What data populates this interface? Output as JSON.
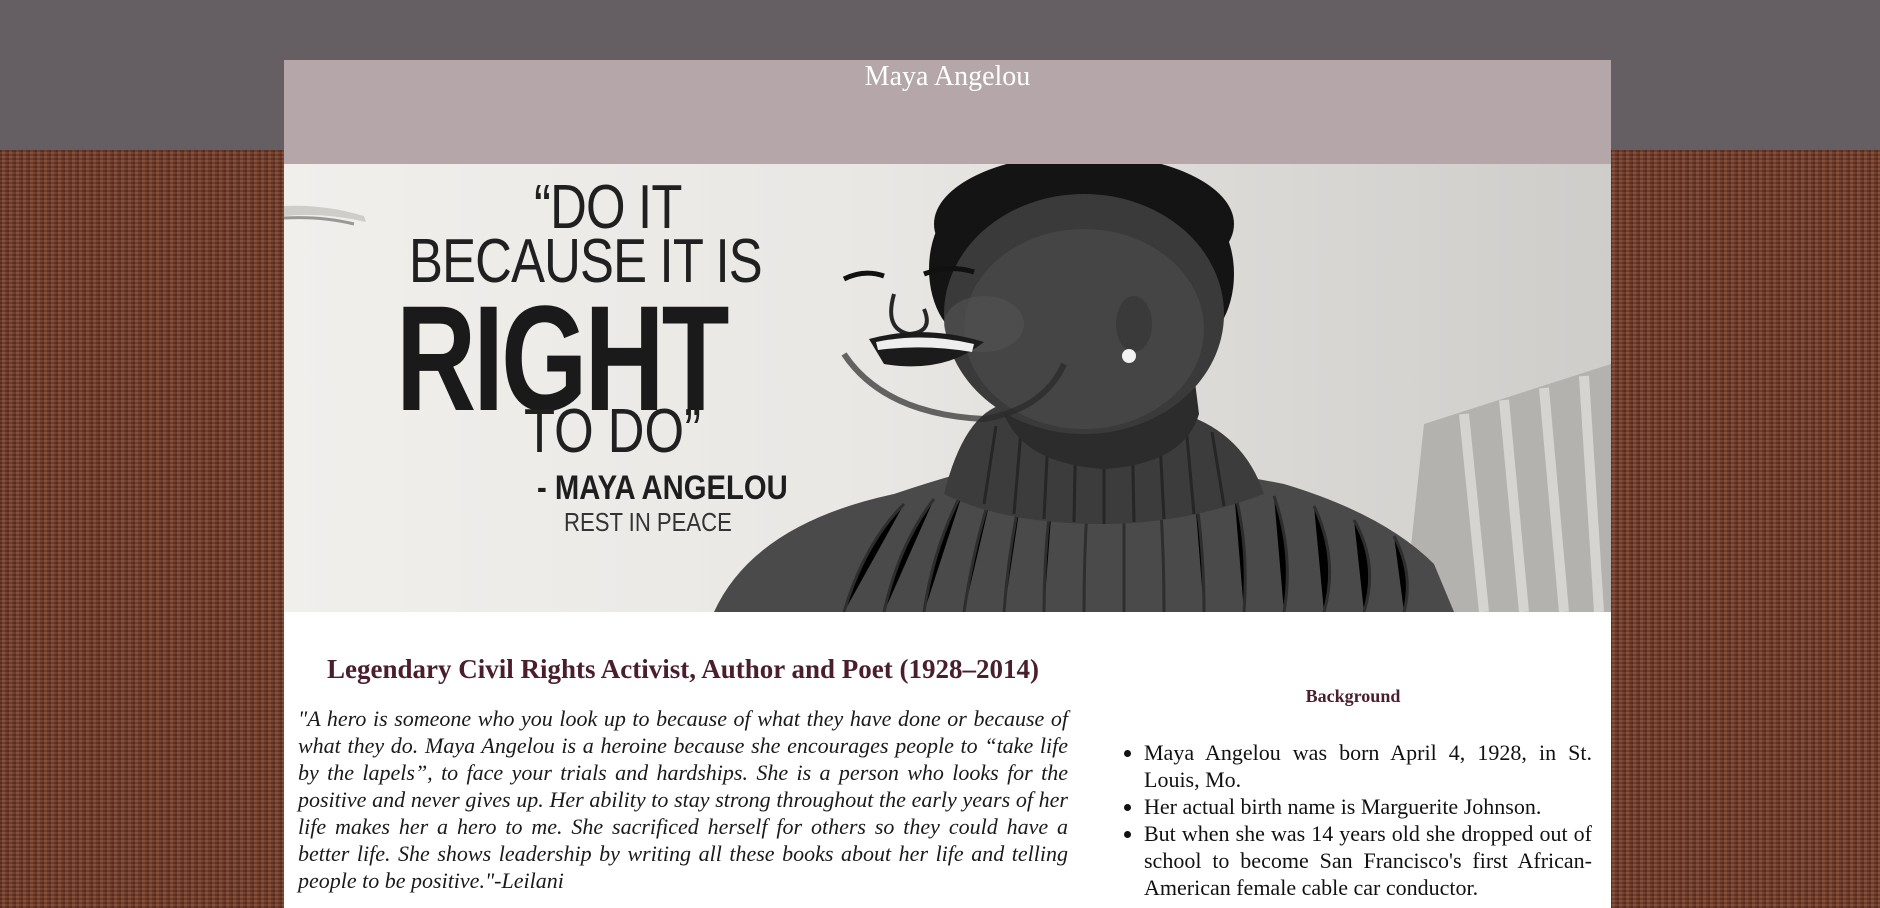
{
  "header": {
    "title": "Maya Angelou"
  },
  "hero": {
    "quote_line1": "“DO IT",
    "quote_line2": "BECAUSE IT IS",
    "quote_line3": "RIGHT",
    "quote_line4": "TO DO”",
    "attribution": "- MAYA ANGELOU",
    "memorial": "REST IN PEACE"
  },
  "main": {
    "headline": "Legendary Civil Rights Activist, Author and Poet (1928–2014)",
    "tribute": "\"A hero is someone who you look up to because of what they have done or because of what they do. Maya Angelou is a heroine because she encourages people to “take life by the lapels”, to face your trials and hardships. She is a person who looks for the positive and never gives up. Her ability to stay strong throughout the early years of her life makes her a hero to me. She sacrificed herself for others so they could have a better life. She shows leadership by writing all these books about her life and telling people to be positive.\"-Leilani"
  },
  "sidebar": {
    "heading": "Background",
    "facts": [
      "Maya Angelou was born April 4, 1928, in St. Louis, Mo.",
      "Her actual birth name is Marguerite Johnson.",
      "But when she was 14 years old she dropped out of school to become San Francisco's first African-American female cable car conductor."
    ]
  },
  "colors": {
    "top_band": "#655f63",
    "header_bg": "#b5a7a9",
    "headline": "#4a1e2b",
    "background_texture": "#7a3f2a"
  }
}
